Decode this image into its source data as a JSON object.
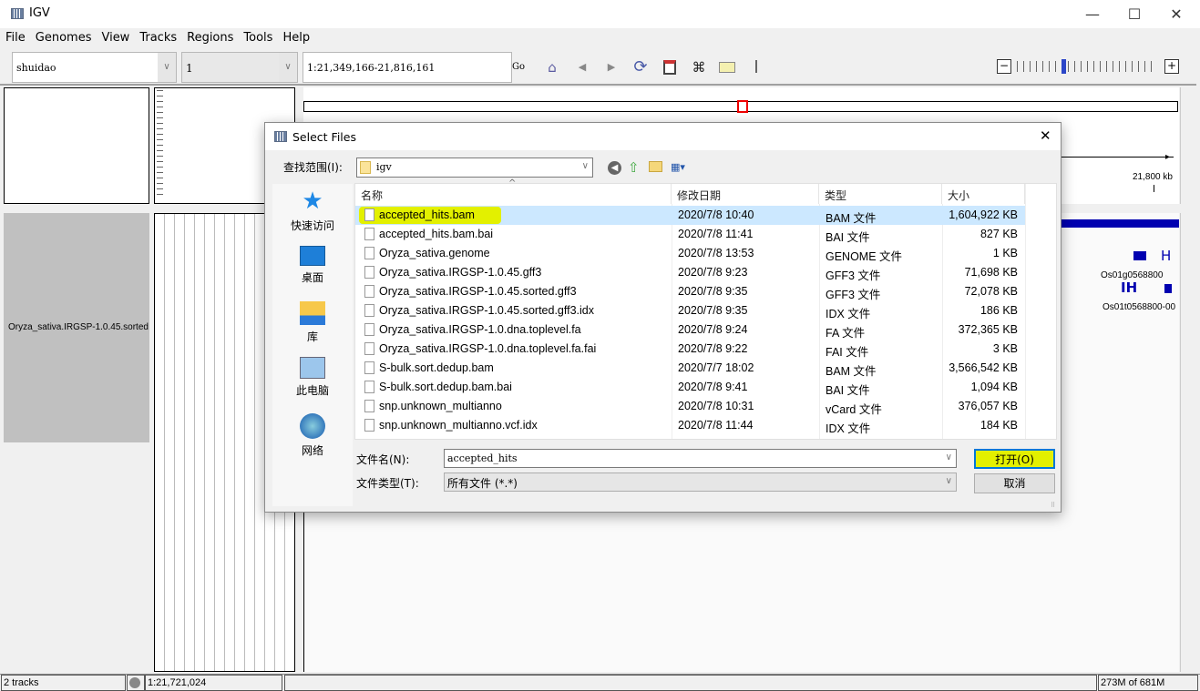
{
  "window": {
    "title": "IGV",
    "minimize": "—",
    "maximize": "☐",
    "close": "✕"
  },
  "menu": [
    "File",
    "Genomes",
    "View",
    "Tracks",
    "Regions",
    "Tools",
    "Help"
  ],
  "toolbar": {
    "genome": "shuidao",
    "chromosome": "1",
    "locus": "1:21,349,166-21,816,161",
    "go_label": "Go"
  },
  "tracks": {
    "feature_track_name": "Oryza_sativa.IRGSP-1.0.45.sorted",
    "ruler_label": "21,800 kb",
    "gene_label": "Os01g0568800",
    "transcript_label": "Os01t0568800-00"
  },
  "dialog": {
    "title": "Select Files",
    "look_in_label": "查找范围(I):",
    "look_in_value": "igv",
    "sidebar": [
      "快速访问",
      "桌面",
      "库",
      "此电脑",
      "网络"
    ],
    "columns": [
      "名称",
      "修改日期",
      "类型",
      "大小"
    ],
    "files": [
      {
        "name": "accepted_hits.bam",
        "date": "2020/7/8 10:40",
        "type": "BAM 文件",
        "size": "1,604,922 KB",
        "selected": true
      },
      {
        "name": "accepted_hits.bam.bai",
        "date": "2020/7/8 11:41",
        "type": "BAI 文件",
        "size": "827 KB"
      },
      {
        "name": "Oryza_sativa.genome",
        "date": "2020/7/8 13:53",
        "type": "GENOME 文件",
        "size": "1 KB"
      },
      {
        "name": "Oryza_sativa.IRGSP-1.0.45.gff3",
        "date": "2020/7/8 9:23",
        "type": "GFF3 文件",
        "size": "71,698 KB"
      },
      {
        "name": "Oryza_sativa.IRGSP-1.0.45.sorted.gff3",
        "date": "2020/7/8 9:35",
        "type": "GFF3 文件",
        "size": "72,078 KB"
      },
      {
        "name": "Oryza_sativa.IRGSP-1.0.45.sorted.gff3.idx",
        "date": "2020/7/8 9:35",
        "type": "IDX 文件",
        "size": "186 KB"
      },
      {
        "name": "Oryza_sativa.IRGSP-1.0.dna.toplevel.fa",
        "date": "2020/7/8 9:24",
        "type": "FA 文件",
        "size": "372,365 KB"
      },
      {
        "name": "Oryza_sativa.IRGSP-1.0.dna.toplevel.fa.fai",
        "date": "2020/7/8 9:22",
        "type": "FAI 文件",
        "size": "3 KB"
      },
      {
        "name": "S-bulk.sort.dedup.bam",
        "date": "2020/7/7 18:02",
        "type": "BAM 文件",
        "size": "3,566,542 KB"
      },
      {
        "name": "S-bulk.sort.dedup.bam.bai",
        "date": "2020/7/8 9:41",
        "type": "BAI 文件",
        "size": "1,094 KB"
      },
      {
        "name": "snp.unknown_multianno",
        "date": "2020/7/8 10:31",
        "type": "vCard 文件",
        "size": "376,057 KB"
      },
      {
        "name": "snp.unknown_multianno.vcf.idx",
        "date": "2020/7/8 11:44",
        "type": "IDX 文件",
        "size": "184 KB"
      }
    ],
    "filename_label": "文件名(N):",
    "filename_value": "accepted_hits",
    "filetype_label": "文件类型(T):",
    "filetype_value": "所有文件 (*.*)",
    "open_label": "打开(O)",
    "cancel_label": "取消",
    "highlight_color": "#e3f000"
  },
  "status": {
    "tracks": "2 tracks",
    "position": "1:21,721,024",
    "memory": "273M of 681M"
  }
}
